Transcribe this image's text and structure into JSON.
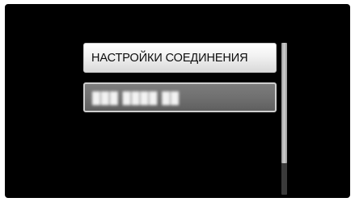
{
  "menu": {
    "items": [
      {
        "label": "НАСТРОЙКИ СОЕДИНЕНИЯ",
        "selected": false
      },
      {
        "label": "███ ████ ██",
        "selected": true,
        "obscured": true
      }
    ]
  },
  "scrollbar": {
    "position_fraction": 0.0,
    "visible_fraction": 0.79
  },
  "colors": {
    "screen_background": "#000000",
    "item_background": "#f1f1f1",
    "selected_item_background": "#707070",
    "scroll_thumb": "#bdbdbd",
    "scroll_track": "#3a3a3a"
  }
}
